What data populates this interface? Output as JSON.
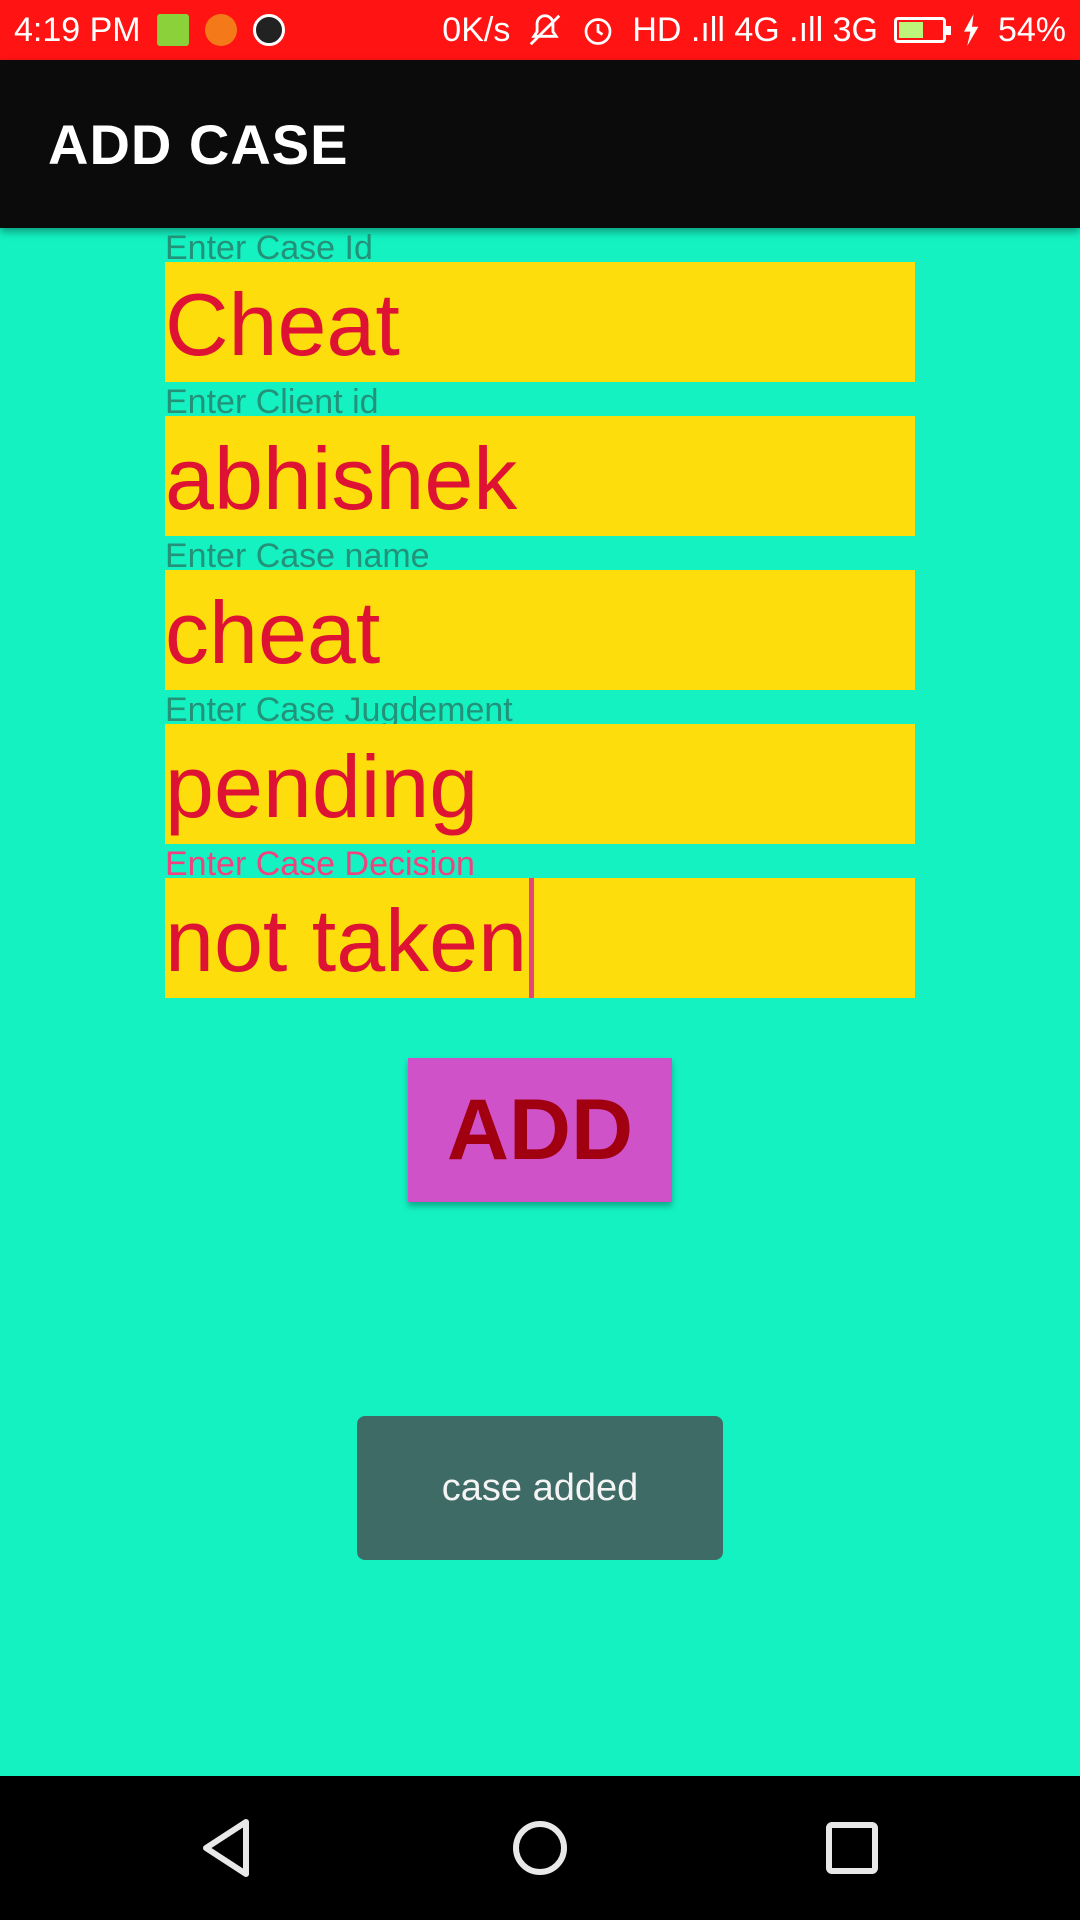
{
  "status_bar": {
    "time": "4:19 PM",
    "network_speed": "0K/s",
    "signal_text": "HD .ıll 4G .ıll 3G",
    "battery_percent": "54%",
    "battery_level": 0.54,
    "icons": [
      "notification-app-icon",
      "notification-crop-icon",
      "notification-call-icon",
      "mute-icon",
      "alarm-icon",
      "battery-icon",
      "charging-icon"
    ]
  },
  "app_bar": {
    "title": "ADD CASE"
  },
  "form": {
    "fields": [
      {
        "label": "Enter Case Id",
        "value": "Cheat"
      },
      {
        "label": "Enter Client id",
        "value": "abhishek"
      },
      {
        "label": "Enter Case name",
        "value": "cheat"
      },
      {
        "label": "Enter Case Jugdement",
        "value": "pending"
      },
      {
        "label": "Enter Case Decision",
        "value": "not taken"
      }
    ],
    "add_label": "ADD"
  },
  "toast": {
    "message": "case added"
  },
  "colors": {
    "background": "#14f2c2",
    "status_bar": "#ff1313",
    "app_bar": "#0b0b0b",
    "field_bg": "#fddd0c",
    "field_text": "#de1333",
    "label": "#239279",
    "label_focused": "#f2417f",
    "button_bg": "#cf52c8",
    "button_text": "#a00010",
    "toast_bg": "#3f6b66"
  },
  "nav_bar": {
    "icons": [
      "back-icon",
      "home-icon",
      "recents-icon"
    ]
  }
}
